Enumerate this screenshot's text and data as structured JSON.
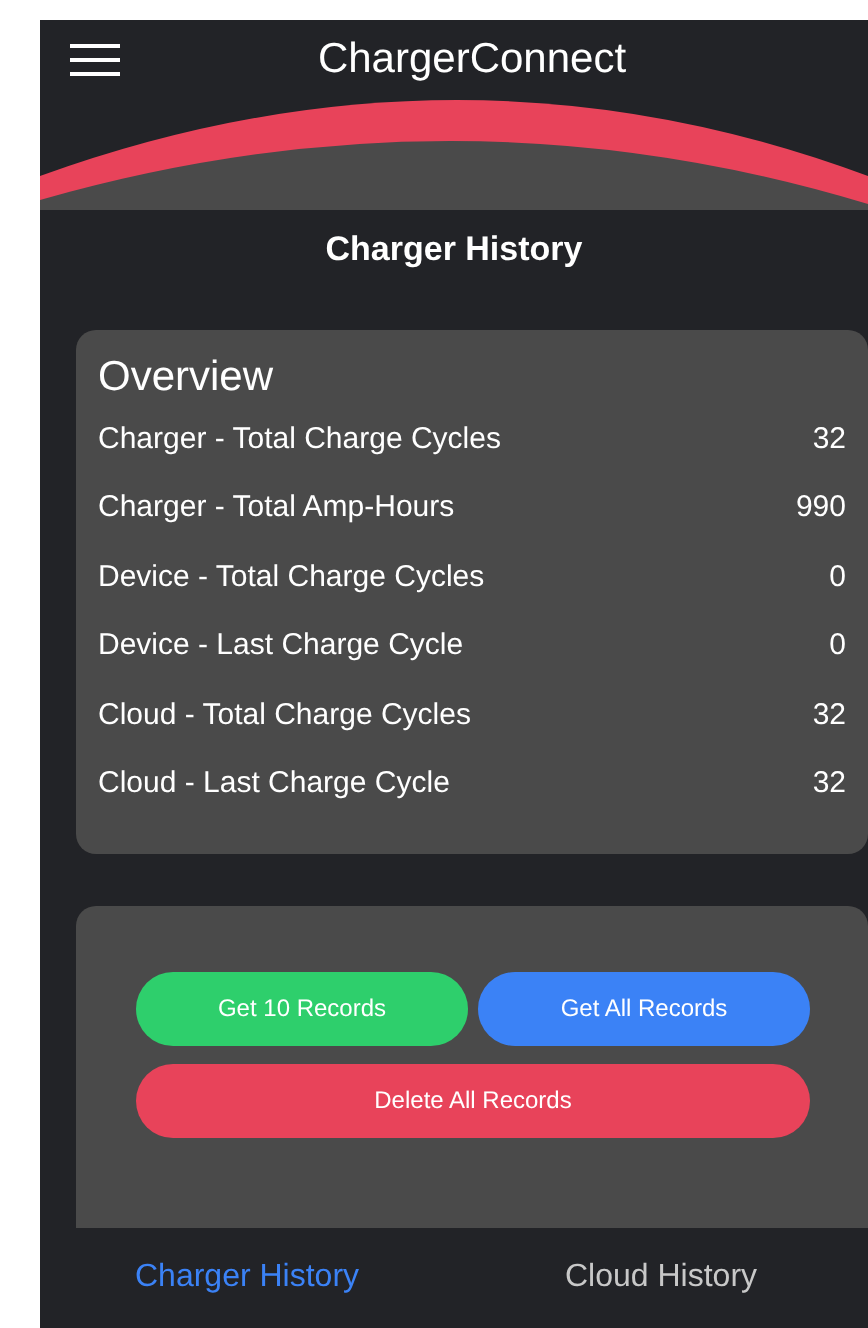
{
  "app_bar": {
    "title": "ChargerConnect"
  },
  "page_title": "Charger History",
  "overview": {
    "title": "Overview",
    "rows": [
      {
        "label": "Charger - Total Charge Cycles",
        "value": "32"
      },
      {
        "label": "Charger - Total Amp-Hours",
        "value": "990"
      },
      {
        "label": "Device - Total Charge Cycles",
        "value": "0"
      },
      {
        "label": "Device - Last Charge Cycle",
        "value": "0"
      },
      {
        "label": "Cloud - Total Charge Cycles",
        "value": "32"
      },
      {
        "label": "Cloud - Last Charge Cycle",
        "value": "32"
      }
    ]
  },
  "actions": [
    {
      "label": "Get 10 Records",
      "kind": "success",
      "wide": false
    },
    {
      "label": "Get All Records",
      "kind": "primary",
      "wide": false
    },
    {
      "label": "Delete All Records",
      "kind": "danger",
      "wide": true
    }
  ],
  "tabs": [
    {
      "label": "Charger History",
      "selected": true
    },
    {
      "label": "Cloud History",
      "selected": false
    }
  ]
}
